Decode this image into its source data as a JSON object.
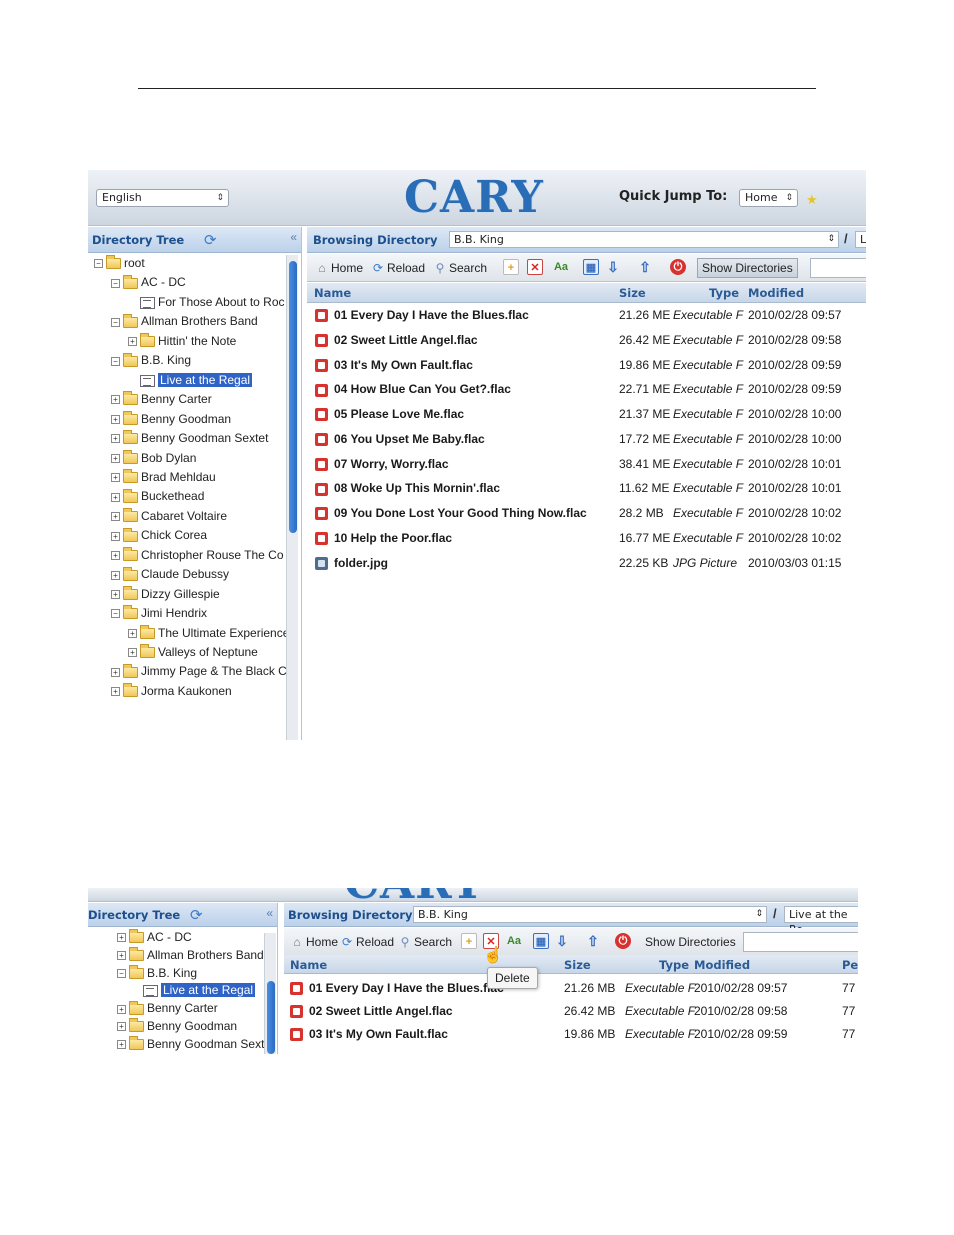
{
  "shot1": {
    "header": {
      "language": "English",
      "logo": "CARY",
      "quick_jump_label": "Quick Jump To:",
      "quick_jump_value": "Home"
    },
    "tree": {
      "title": "Directory Tree",
      "collapse": "«",
      "nodes": [
        {
          "label": "root",
          "level": 0,
          "type": "folder",
          "expander": "minus"
        },
        {
          "label": "AC - DC",
          "level": 1,
          "type": "folder",
          "expander": "minus"
        },
        {
          "label": "For Those About to Roc",
          "level": 2,
          "type": "doc",
          "expander": ""
        },
        {
          "label": "Allman Brothers Band",
          "level": 1,
          "type": "folder",
          "expander": "minus"
        },
        {
          "label": "Hittin' the Note",
          "level": 2,
          "type": "plain",
          "expander": "plus"
        },
        {
          "label": "B.B. King",
          "level": 1,
          "type": "folder",
          "expander": "minus"
        },
        {
          "label": "Live at the Regal",
          "level": 2,
          "type": "doc",
          "expander": "",
          "selected": true
        },
        {
          "label": "Benny Carter",
          "level": 1,
          "type": "folder",
          "expander": "plus"
        },
        {
          "label": "Benny Goodman",
          "level": 1,
          "type": "folder",
          "expander": "plus"
        },
        {
          "label": "Benny Goodman Sextet",
          "level": 1,
          "type": "folder",
          "expander": "plus"
        },
        {
          "label": "Bob Dylan",
          "level": 1,
          "type": "folder",
          "expander": "plus"
        },
        {
          "label": "Brad Mehldau",
          "level": 1,
          "type": "folder",
          "expander": "plus"
        },
        {
          "label": "Buckethead",
          "level": 1,
          "type": "folder",
          "expander": "plus"
        },
        {
          "label": "Cabaret Voltaire",
          "level": 1,
          "type": "folder",
          "expander": "plus"
        },
        {
          "label": "Chick Corea",
          "level": 1,
          "type": "folder",
          "expander": "plus"
        },
        {
          "label": "Christopher Rouse The Co",
          "level": 1,
          "type": "folder",
          "expander": "plus"
        },
        {
          "label": "Claude Debussy",
          "level": 1,
          "type": "folder",
          "expander": "plus"
        },
        {
          "label": "Dizzy Gillespie",
          "level": 1,
          "type": "folder",
          "expander": "plus"
        },
        {
          "label": "Jimi Hendrix",
          "level": 1,
          "type": "folder",
          "expander": "minus"
        },
        {
          "label": "The Ultimate Experience",
          "level": 2,
          "type": "folder",
          "expander": "plus"
        },
        {
          "label": "Valleys of Neptune",
          "level": 2,
          "type": "folder",
          "expander": "plus"
        },
        {
          "label": "Jimmy Page & The Black C",
          "level": 1,
          "type": "folder",
          "expander": "plus"
        },
        {
          "label": "Jorma Kaukonen",
          "level": 1,
          "type": "folder",
          "expander": "plus"
        }
      ]
    },
    "browse": {
      "title": "Browsing Directory",
      "path": "B.B. King",
      "path_sep": "/",
      "path_next": "L",
      "toolbar": {
        "home": "Home",
        "reload": "Reload",
        "search": "Search",
        "show_dirs": "Show Directories"
      },
      "columns": {
        "name": "Name",
        "size": "Size",
        "type": "Type",
        "modified": "Modified"
      },
      "files": [
        {
          "name": "01 Every Day I Have the Blues.flac",
          "size": "21.26 ME",
          "type": "Executable F",
          "modified": "2010/02/28 09:57",
          "kind": "flac"
        },
        {
          "name": "02 Sweet Little Angel.flac",
          "size": "26.42 ME",
          "type": "Executable F",
          "modified": "2010/02/28 09:58",
          "kind": "flac"
        },
        {
          "name": "03 It's My Own Fault.flac",
          "size": "19.86 ME",
          "type": "Executable F",
          "modified": "2010/02/28 09:59",
          "kind": "flac"
        },
        {
          "name": "04 How Blue Can You Get?.flac",
          "size": "22.71 ME",
          "type": "Executable F",
          "modified": "2010/02/28 09:59",
          "kind": "flac"
        },
        {
          "name": "05 Please Love Me.flac",
          "size": "21.37 ME",
          "type": "Executable F",
          "modified": "2010/02/28 10:00",
          "kind": "flac"
        },
        {
          "name": "06 You Upset Me Baby.flac",
          "size": "17.72 ME",
          "type": "Executable F",
          "modified": "2010/02/28 10:00",
          "kind": "flac"
        },
        {
          "name": "07 Worry, Worry.flac",
          "size": "38.41 ME",
          "type": "Executable F",
          "modified": "2010/02/28 10:01",
          "kind": "flac"
        },
        {
          "name": "08 Woke Up This Mornin'.flac",
          "size": "11.62 ME",
          "type": "Executable F",
          "modified": "2010/02/28 10:01",
          "kind": "flac"
        },
        {
          "name": "09 You Done Lost Your Good Thing Now.flac",
          "size": "28.2 MB",
          "type": "Executable F",
          "modified": "2010/02/28 10:02",
          "kind": "flac"
        },
        {
          "name": "10 Help the Poor.flac",
          "size": "16.77 ME",
          "type": "Executable F",
          "modified": "2010/02/28 10:02",
          "kind": "flac"
        },
        {
          "name": "folder.jpg",
          "size": "22.25 KB",
          "type": "JPG Picture",
          "modified": "2010/03/03 01:15",
          "kind": "image"
        }
      ]
    }
  },
  "shot2": {
    "logo": "CARY",
    "tree": {
      "title": "Directory Tree",
      "collapse": "«",
      "nodes": [
        {
          "label": "AC - DC",
          "level": 1,
          "type": "folder",
          "expander": "plus"
        },
        {
          "label": "Allman Brothers Band",
          "level": 1,
          "type": "folder",
          "expander": "plus"
        },
        {
          "label": "B.B. King",
          "level": 1,
          "type": "folder",
          "expander": "minus"
        },
        {
          "label": "Live at the Regal",
          "level": 2,
          "type": "doc",
          "expander": "",
          "selected": true
        },
        {
          "label": "Benny Carter",
          "level": 1,
          "type": "folder",
          "expander": "plus"
        },
        {
          "label": "Benny Goodman",
          "level": 1,
          "type": "folder",
          "expander": "plus"
        },
        {
          "label": "Benny Goodman Sextet",
          "level": 1,
          "type": "folder",
          "expander": "plus"
        }
      ]
    },
    "browse": {
      "title": "Browsing Directory",
      "path": "B.B. King",
      "path_sep": "/",
      "path_next": "Live at the Re",
      "toolbar": {
        "home": "Home",
        "reload": "Reload",
        "search": "Search",
        "show_dirs": "Show Directories"
      },
      "tooltip": "Delete",
      "columns": {
        "name": "Name",
        "size": "Size",
        "type": "Type",
        "modified": "Modified",
        "perm": "Pe"
      },
      "files": [
        {
          "name": "01 Every Day I Have the Blues.flac",
          "size": "21.26 MB",
          "type": "Executable F",
          "modified": "2010/02/28 09:57",
          "perm": "77"
        },
        {
          "name": "02 Sweet Little Angel.flac",
          "size": "26.42 MB",
          "type": "Executable F",
          "modified": "2010/02/28 09:58",
          "perm": "77"
        },
        {
          "name": "03 It's My Own Fault.flac",
          "size": "19.86 MB",
          "type": "Executable F",
          "modified": "2010/02/28 09:59",
          "perm": "77"
        }
      ]
    }
  },
  "colors": {
    "accent": "#2f63c6",
    "heading": "#1c4f8c",
    "logo": "#2a6db7",
    "flac_icon": "#d8322f"
  }
}
